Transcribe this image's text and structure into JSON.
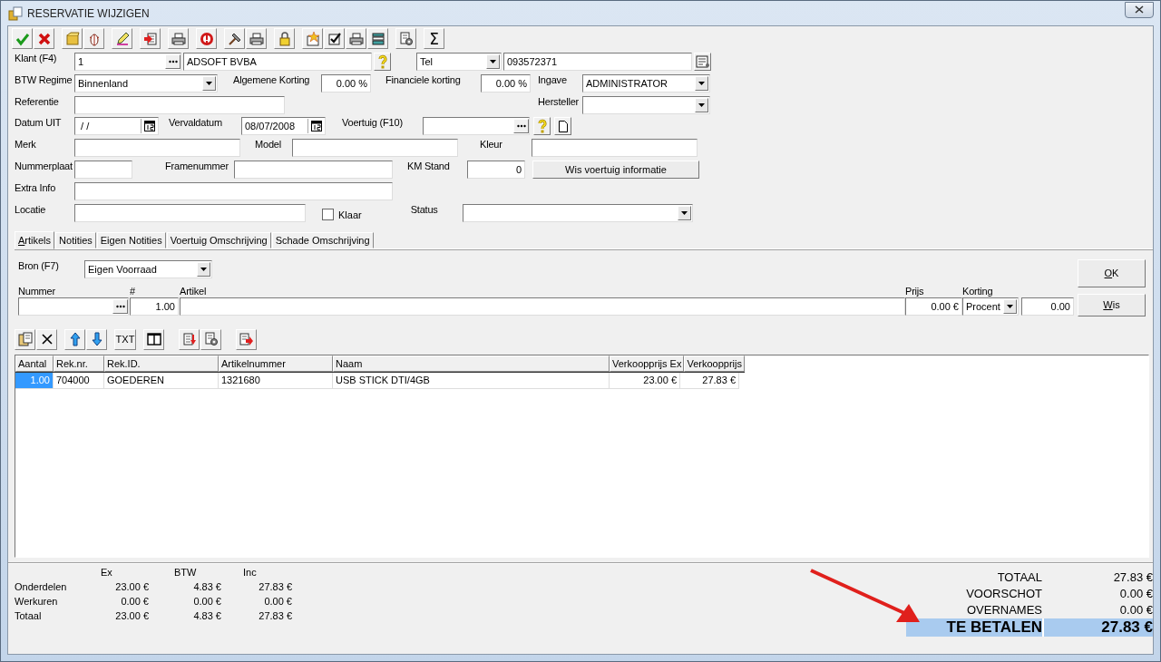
{
  "window": {
    "title": "RESERVATIE WIJZIGEN"
  },
  "toolbar": {
    "sum_button": "Σ"
  },
  "form": {
    "klant": {
      "label": "Klant (F4)",
      "number": "1",
      "name": "ADSOFT BVBA"
    },
    "contact": {
      "type": "Tel",
      "value": "093572371"
    },
    "btw_regime": {
      "label": "BTW Regime",
      "value": "Binnenland"
    },
    "algemene_korting": {
      "label": "Algemene Korting",
      "value": "0.00 %"
    },
    "financiele_korting": {
      "label": "Financiele korting",
      "value": "0.00 %"
    },
    "ingave": {
      "label": "Ingave",
      "value": "ADMINISTRATOR"
    },
    "referentie": {
      "label": "Referentie"
    },
    "hersteller": {
      "label": "Hersteller"
    },
    "datum_uit": {
      "label": "Datum UIT",
      "value": " / /"
    },
    "vervaldatum": {
      "label": "Vervaldatum",
      "value": "08/07/2008"
    },
    "voertuig": {
      "label": "Voertuig (F10)"
    },
    "merk": {
      "label": "Merk"
    },
    "model": {
      "label": "Model"
    },
    "kleur": {
      "label": "Kleur"
    },
    "nummerplaat": {
      "label": "Nummerplaat"
    },
    "framenummer": {
      "label": "Framenummer"
    },
    "km_stand": {
      "label": "KM Stand",
      "value": "0"
    },
    "wis_voertuig_button": "Wis voertuig informatie",
    "extra_info": {
      "label": "Extra Info"
    },
    "locatie": {
      "label": "Locatie"
    },
    "klaar": {
      "label": "Klaar",
      "checked": false
    },
    "status": {
      "label": "Status"
    }
  },
  "tabs": [
    {
      "label": "Artikels",
      "selected": true
    },
    {
      "label": "Notities",
      "selected": false
    },
    {
      "label": "Eigen Notities",
      "selected": false
    },
    {
      "label": "Voertuig Omschrijving",
      "selected": false
    },
    {
      "label": "Schade Omschrijving",
      "selected": false
    }
  ],
  "articles": {
    "bron": {
      "label": "Bron (F7)",
      "value": "Eigen Voorraad"
    },
    "nummer_label": "Nummer",
    "count_label": "#",
    "count_value": "1.00",
    "artikel_label": "Artikel",
    "prijs_label": "Prijs",
    "prijs_value": "0.00 €",
    "korting_label": "Korting",
    "korting_type": "Procent",
    "korting_value": "0.00",
    "ok_button": "OK",
    "wis_button": "Wis",
    "txt_button": "TXT"
  },
  "table": {
    "columns": [
      "Aantal",
      "Rek.nr.",
      "Rek.ID.",
      "Artikelnummer",
      "Naam",
      "Verkoopprijs Ex",
      "Verkoopprijs"
    ],
    "rows": [
      {
        "selected": true,
        "cells": [
          "1.00",
          "704000",
          "GOEDEREN",
          "1321680",
          "USB STICK DTI/4GB",
          "23.00 €",
          "27.83 €"
        ]
      }
    ]
  },
  "summary": {
    "columns": [
      "Ex",
      "BTW",
      "Inc"
    ],
    "rows": [
      {
        "label": "Onderdelen",
        "values": [
          "23.00 €",
          "4.83 €",
          "27.83 €"
        ]
      },
      {
        "label": "Werkuren",
        "values": [
          "0.00 €",
          "0.00 €",
          "0.00 €"
        ]
      },
      {
        "label": "Totaal",
        "values": [
          "23.00 €",
          "4.83 €",
          "27.83 €"
        ]
      }
    ]
  },
  "totals": [
    {
      "label": "TOTAAL",
      "value": "27.83 €",
      "kind": "normal"
    },
    {
      "label": "VOORSCHOT",
      "value": "0.00 €",
      "kind": "normal"
    },
    {
      "label": "OVERNAMES",
      "value": "0.00 €",
      "kind": "normal"
    },
    {
      "label": "TE BETALEN",
      "value": "27.83 €",
      "kind": "highlight"
    }
  ]
}
